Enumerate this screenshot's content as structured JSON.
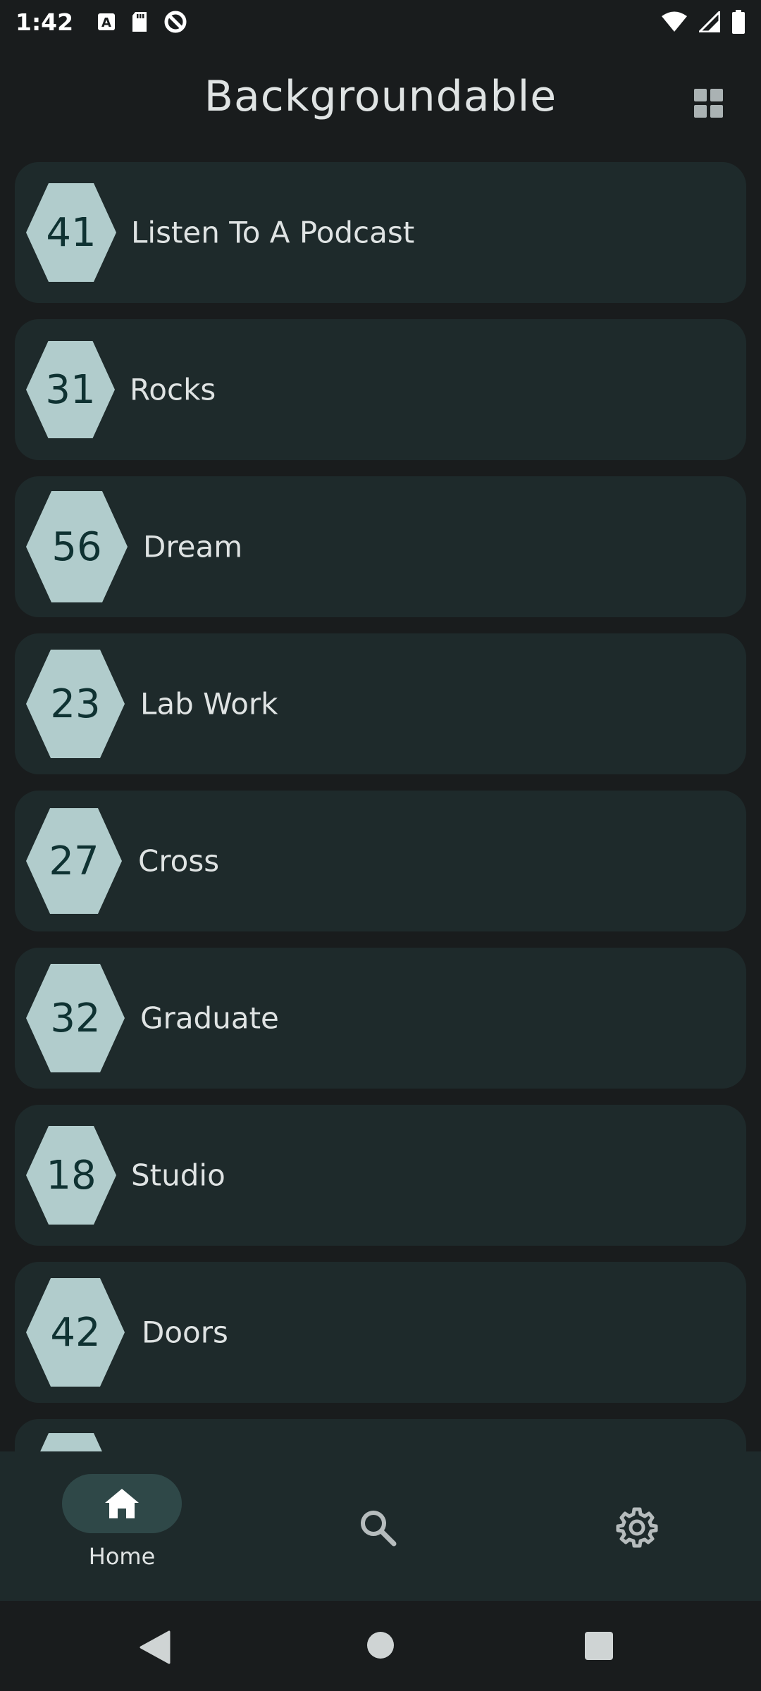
{
  "status_bar": {
    "time": "1:42"
  },
  "header": {
    "title": "Backgroundable",
    "view_toggle_icon": "grid-view-icon"
  },
  "items": [
    {
      "count": "41",
      "label": "Listen To A Podcast"
    },
    {
      "count": "31",
      "label": "Rocks"
    },
    {
      "count": "56",
      "label": "Dream"
    },
    {
      "count": "23",
      "label": "Lab Work"
    },
    {
      "count": "27",
      "label": "Cross"
    },
    {
      "count": "32",
      "label": "Graduate"
    },
    {
      "count": "18",
      "label": "Studio"
    },
    {
      "count": "42",
      "label": "Doors"
    },
    {
      "count": "",
      "label": ""
    }
  ],
  "bottom_nav": {
    "home_label": "Home",
    "home_icon": "home-icon",
    "search_icon": "search-icon",
    "settings_icon": "gear-icon"
  },
  "colors": {
    "background": "#191c1d",
    "card": "#1e2a2b",
    "hexagon": "#b1cccc",
    "hexagon_text": "#0f3232",
    "nav_active_pill": "#2f4848"
  }
}
